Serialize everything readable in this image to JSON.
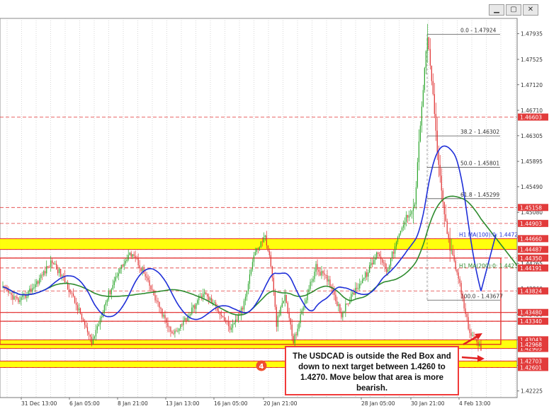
{
  "window_buttons": [
    {
      "name": "minimize-button",
      "glyph": "▁"
    },
    {
      "name": "restore-button",
      "glyph": "▢"
    },
    {
      "name": "close-button",
      "glyph": "✕"
    }
  ],
  "annotation_text": "The USDCAD is outside the Red Box and down to next target between 1.4260 to 1.4270. Move below that area is more bearish.",
  "circle_label": "4",
  "chart_data": {
    "type": "line",
    "timeframe_label": "",
    "x_ticks": [
      "31 Dec 13:00",
      "6 Jan 05:00",
      "8 Jan 21:00",
      "13 Jan 13:00",
      "16 Jan 05:00",
      "20 Jan 21:00",
      "28 Jan 05:00",
      "30 Jan 21:00",
      "4 Feb 13:00"
    ],
    "y_ticks": [
      1.47935,
      1.47525,
      1.4712,
      1.4671,
      1.46305,
      1.45895,
      1.4549,
      1.4508,
      1.44675,
      1.44265,
      1.4386,
      1.4345,
      1.43045,
      1.42635,
      1.42225
    ],
    "ylim": [
      1.4212,
      1.4818
    ],
    "price_range": [
      1.4262,
      1.4793
    ],
    "horizontal_levels": [
      {
        "value": 1.46603,
        "label": "1.46603"
      },
      {
        "value": 1.45158,
        "label": "1.45158"
      },
      {
        "value": 1.44903,
        "label": "1.44903"
      },
      {
        "value": 1.4466,
        "label": "1.44660"
      },
      {
        "value": 1.44487,
        "label": "1.44487"
      },
      {
        "value": 1.4435,
        "label": "1.44350"
      },
      {
        "value": 1.44191,
        "label": "1.44191"
      },
      {
        "value": 1.43824,
        "label": "1.43824"
      },
      {
        "value": 1.4348,
        "label": "1.43480"
      },
      {
        "value": 1.4334,
        "label": "1.43340"
      },
      {
        "value": 1.43043,
        "label": "1.43043"
      },
      {
        "value": 1.42905,
        "label": "1.42905"
      },
      {
        "value": 1.42703,
        "label": "1.42703"
      },
      {
        "value": 1.42601,
        "label": "1.42601"
      }
    ],
    "current_price": {
      "value": 1.42968,
      "label": "1.42968"
    },
    "fib_levels": [
      {
        "label": "0.0 - 1.47924",
        "value": 1.47924
      },
      {
        "label": "38.2 - 1.46302",
        "value": 1.46302
      },
      {
        "label": "50.0 - 1.45801",
        "value": 1.45801
      },
      {
        "label": "61.8 - 1.45299",
        "value": 1.45299
      },
      {
        "label": "100.0 - 1.43677",
        "value": 1.43677
      }
    ],
    "moving_averages": [
      {
        "label": "H1 MA(100):0: 1.44725",
        "value": 1.44725,
        "color": "#1f2fd8"
      },
      {
        "label": "H1 MA(200):0: 1.44231",
        "value": 1.44231,
        "color": "#2e8b2e"
      }
    ],
    "yellow_zones": [
      [
        1.44487,
        1.4466
      ],
      [
        1.42905,
        1.43043
      ],
      [
        1.42601,
        1.42703
      ]
    ],
    "red_box": {
      "top": 1.4435,
      "bottom": 1.4297
    },
    "red_lines": [
      1.4348,
      1.4334
    ],
    "colors": {
      "candle_up": "#2aa52a",
      "candle_down": "#e03030",
      "level_line": "#e23b3b",
      "yellow_zone": "#ffff00",
      "red_box": "#e22222",
      "ma100": "#1f2fd8",
      "ma200": "#2e8b2e",
      "grid": "#bdbdbd",
      "fib": "#555555"
    }
  }
}
